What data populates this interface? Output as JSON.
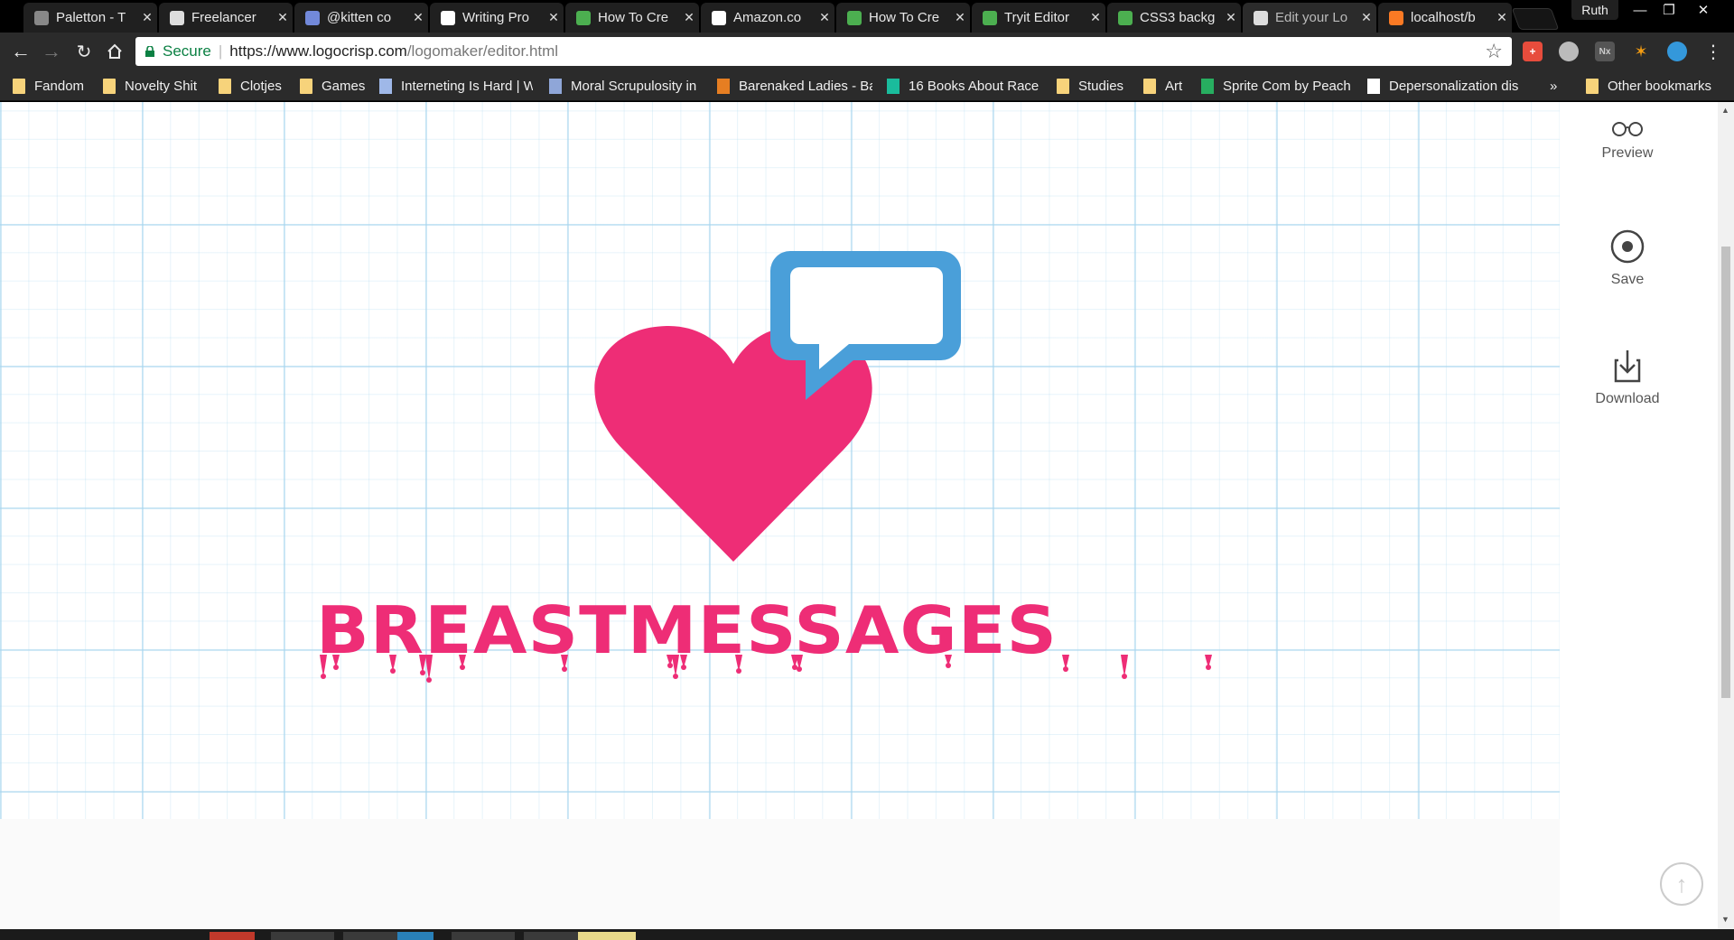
{
  "tabs": [
    {
      "title": "Paletton - T",
      "favicon": "paletton-icon",
      "color": "#888888",
      "active": false
    },
    {
      "title": "Freelancer",
      "favicon": "page-icon",
      "color": "#dddddd",
      "active": false
    },
    {
      "title": "@kitten co",
      "favicon": "discord-icon",
      "color": "#7289da",
      "active": false
    },
    {
      "title": "Writing Pro",
      "favicon": "reddit-icon",
      "color": "#ffffff",
      "active": false
    },
    {
      "title": "How To Cre",
      "favicon": "w3-icon",
      "color": "#4caf50",
      "active": false
    },
    {
      "title": "Amazon.co",
      "favicon": "amazon-icon",
      "color": "#ffffff",
      "active": false
    },
    {
      "title": "How To Cre",
      "favicon": "w3-icon",
      "color": "#4caf50",
      "active": false
    },
    {
      "title": "Tryit Editor",
      "favicon": "w3-icon",
      "color": "#4caf50",
      "active": false
    },
    {
      "title": "CSS3 backg",
      "favicon": "w3-icon",
      "color": "#4caf50",
      "active": false
    },
    {
      "title": "Edit your Lo",
      "favicon": "page-icon",
      "color": "#dddddd",
      "active": true
    },
    {
      "title": "localhost/b",
      "favicon": "xampp-icon",
      "color": "#fb7a24",
      "active": false
    }
  ],
  "profile_name": "Ruth",
  "address": {
    "secure_label": "Secure",
    "url_base": "https://www.logocrisp.com",
    "url_path": "/logomaker/editor.html"
  },
  "bookmarks": [
    {
      "label": "Fandom",
      "icon": "folder-icon"
    },
    {
      "label": "Novelty Shit",
      "icon": "folder-icon"
    },
    {
      "label": "Clotjes",
      "icon": "folder-icon"
    },
    {
      "label": "Games",
      "icon": "folder-icon"
    },
    {
      "label": "Interneting Is Hard | W",
      "icon": "interneting-icon"
    },
    {
      "label": "Moral Scrupulosity in",
      "icon": "grid-icon"
    },
    {
      "label": "Barenaked Ladies - Ba",
      "icon": "bnl-icon"
    },
    {
      "label": "16 Books About Race",
      "icon": "books-icon"
    },
    {
      "label": "Studies",
      "icon": "folder-icon"
    },
    {
      "label": "Art",
      "icon": "folder-icon"
    },
    {
      "label": "Sprite Com by Peach",
      "icon": "sprite-icon"
    },
    {
      "label": "Depersonalization dis",
      "icon": "wikipedia-icon"
    }
  ],
  "bookmarks_overflow": "»",
  "other_bookmarks": "Other bookmarks",
  "logo": {
    "wordmark": "BREASTMESSAGES",
    "heart_color": "#ee2d76",
    "bubble_color": "#4a9fd9"
  },
  "side_actions": [
    {
      "label": "Preview",
      "icon": "glasses-icon"
    },
    {
      "label": "Save",
      "icon": "target-icon"
    },
    {
      "label": "Download",
      "icon": "download-icon"
    }
  ]
}
